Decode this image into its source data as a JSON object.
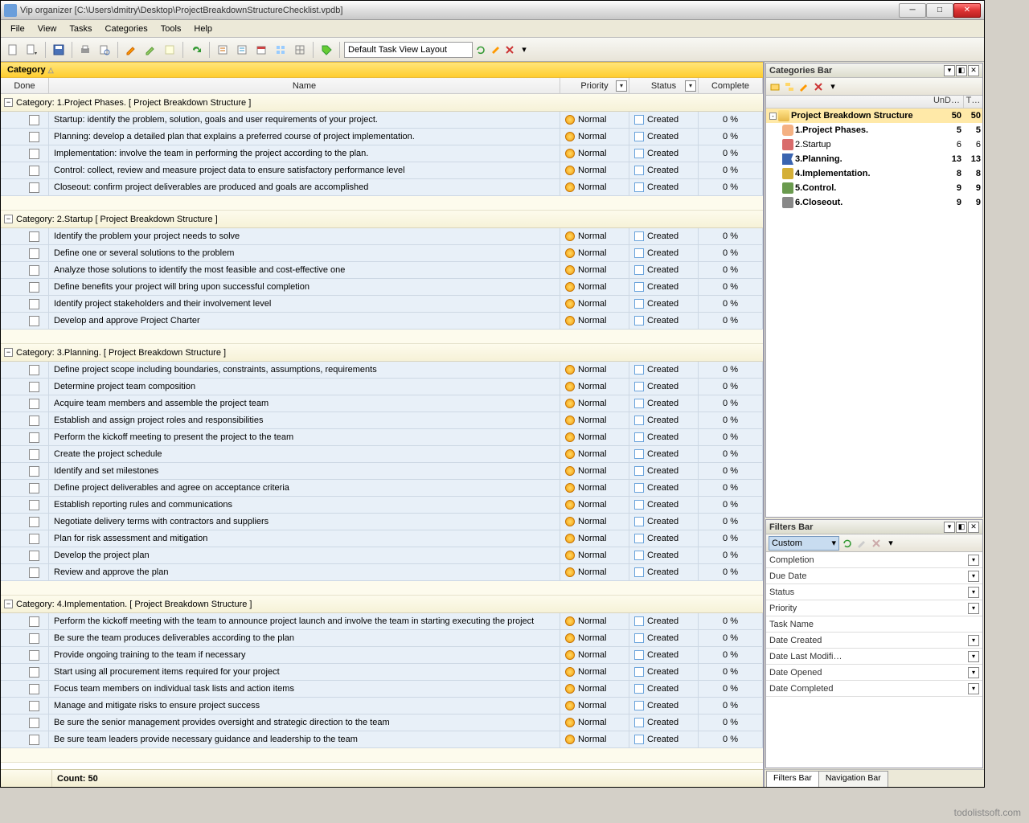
{
  "title": "Vip organizer [C:\\Users\\dmitry\\Desktop\\ProjectBreakdownStructureChecklist.vpdb]",
  "menu": [
    "File",
    "View",
    "Tasks",
    "Categories",
    "Tools",
    "Help"
  ],
  "layout": "Default Task View Layout",
  "groupby": "Category",
  "columns": {
    "done": "Done",
    "name": "Name",
    "priority": "Priority",
    "status": "Status",
    "complete": "Complete"
  },
  "priorityLabel": "Normal",
  "statusLabel": "Created",
  "pct": "0 %",
  "groups": [
    {
      "header": "Category: 1.Project Phases.    [ Project Breakdown Structure ]",
      "tasks": [
        "Startup: identify the problem, solution, goals and user requirements of your project.",
        "Planning: develop a detailed plan that explains a preferred course of project implementation.",
        "Implementation: involve the team in performing the project according to the plan.",
        "Control: collect, review and measure project data to ensure satisfactory performance level",
        "Closeout: confirm project deliverables are produced and goals are accomplished"
      ]
    },
    {
      "header": "Category: 2.Startup    [ Project Breakdown Structure ]",
      "tasks": [
        "Identify the problem your project needs to solve",
        "Define one or several solutions to the problem",
        "Analyze those solutions to identify the most feasible and cost-effective one",
        "Define benefits your project will bring upon successful completion",
        "Identify project stakeholders and their involvement level",
        "Develop and approve Project Charter"
      ]
    },
    {
      "header": "Category: 3.Planning.    [ Project Breakdown Structure ]",
      "tasks": [
        "Define project scope including boundaries, constraints, assumptions, requirements",
        "Determine project team composition",
        "Acquire team members and assemble the project team",
        "Establish and assign project roles and responsibilities",
        "Perform the kickoff meeting to present the project to the team",
        "Create the project schedule",
        "Identify and set milestones",
        "Define project deliverables and agree on acceptance criteria",
        "Establish reporting rules and communications",
        "Negotiate delivery terms with contractors and suppliers",
        "Plan for risk assessment and mitigation",
        "Develop the project plan",
        "Review and approve the plan"
      ]
    },
    {
      "header": "Category: 4.Implementation.    [ Project Breakdown Structure ]",
      "tasks": [
        "Perform the kickoff meeting with the team to announce project launch and involve the team in starting executing the project",
        "Be sure the team produces deliverables according to the plan",
        "Provide ongoing training to the team if necessary",
        "Start using all procurement items required for your project",
        "Focus team members on individual task lists and action items",
        "Manage and mitigate risks to ensure project success",
        "Be sure the senior management provides oversight and strategic direction to the team",
        "Be sure team leaders provide necessary guidance and leadership to the team"
      ]
    }
  ],
  "countLabel": "Count:  50",
  "catbar": {
    "title": "Categories Bar",
    "headers": [
      "UnD…",
      "T…"
    ],
    "items": [
      {
        "label": "Project Breakdown Structure",
        "a": 50,
        "b": 50,
        "icon": "folder",
        "indent": 0,
        "sel": true,
        "exp": "-"
      },
      {
        "label": "1.Project Phases.",
        "a": 5,
        "b": 5,
        "icon": "people",
        "indent": 1,
        "bold": true
      },
      {
        "label": "2.Startup",
        "a": 6,
        "b": 6,
        "icon": "cal",
        "indent": 1
      },
      {
        "label": "3.Planning.",
        "a": 13,
        "b": 13,
        "icon": "flag",
        "indent": 1,
        "bold": true
      },
      {
        "label": "4.Implementation.",
        "a": 8,
        "b": 8,
        "icon": "key",
        "indent": 1,
        "bold": true
      },
      {
        "label": "5.Control.",
        "a": 9,
        "b": 9,
        "icon": "check",
        "indent": 1,
        "bold": true
      },
      {
        "label": "6.Closeout.",
        "a": 9,
        "b": 9,
        "icon": "wrench",
        "indent": 1,
        "bold": true
      }
    ]
  },
  "filterbar": {
    "title": "Filters Bar",
    "custom": "Custom",
    "items": [
      "Completion",
      "Due Date",
      "Status",
      "Priority",
      "Task Name",
      "Date Created",
      "Date Last Modifi…",
      "Date Opened",
      "Date Completed"
    ]
  },
  "tabs": [
    "Filters Bar",
    "Navigation Bar"
  ],
  "watermark": "todolistsoft.com"
}
